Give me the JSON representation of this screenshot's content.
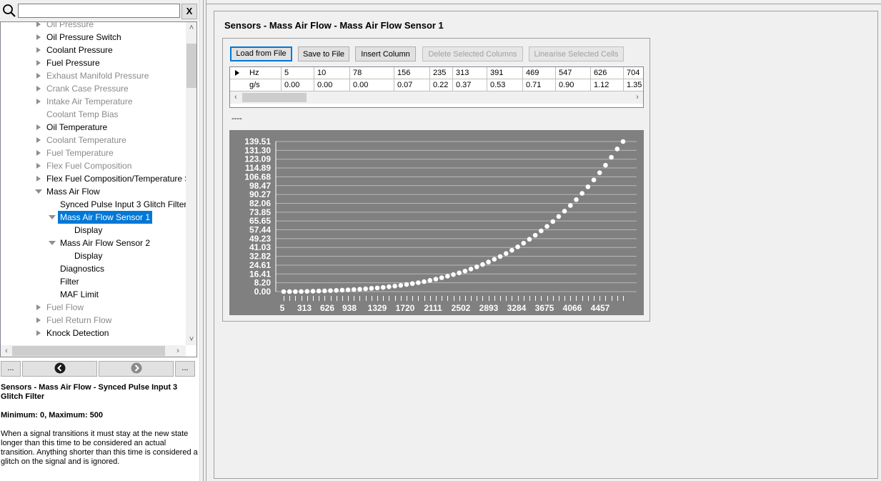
{
  "search": {
    "value": "",
    "clear_label": "X"
  },
  "tree": [
    {
      "label": "Oil Pressure",
      "level": 1,
      "arrow": "right",
      "disabled": true
    },
    {
      "label": "Oil Pressure Switch",
      "level": 1,
      "arrow": "right",
      "disabled": false
    },
    {
      "label": "Coolant Pressure",
      "level": 1,
      "arrow": "right",
      "disabled": false
    },
    {
      "label": "Fuel Pressure",
      "level": 1,
      "arrow": "right",
      "disabled": false
    },
    {
      "label": "Exhaust Manifold Pressure",
      "level": 1,
      "arrow": "right",
      "disabled": true
    },
    {
      "label": "Crank Case Pressure",
      "level": 1,
      "arrow": "right",
      "disabled": true
    },
    {
      "label": "Intake Air Temperature",
      "level": 1,
      "arrow": "right",
      "disabled": true
    },
    {
      "label": "Coolant Temp Bias",
      "level": 1,
      "arrow": "none",
      "disabled": true
    },
    {
      "label": "Oil Temperature",
      "level": 1,
      "arrow": "right",
      "disabled": false
    },
    {
      "label": "Coolant Temperature",
      "level": 1,
      "arrow": "right",
      "disabled": true
    },
    {
      "label": "Fuel Temperature",
      "level": 1,
      "arrow": "right",
      "disabled": true
    },
    {
      "label": "Flex Fuel Composition",
      "level": 1,
      "arrow": "right",
      "disabled": true
    },
    {
      "label": "Flex Fuel Composition/Temperature S",
      "level": 1,
      "arrow": "right",
      "disabled": false
    },
    {
      "label": "Mass Air Flow",
      "level": 1,
      "arrow": "down",
      "disabled": false
    },
    {
      "label": "Synced Pulse Input 3 Glitch Filter",
      "level": 2,
      "arrow": "none",
      "disabled": false
    },
    {
      "label": "Mass Air Flow Sensor 1",
      "level": 2,
      "arrow": "down",
      "disabled": false,
      "selected": true
    },
    {
      "label": "Display",
      "level": 3,
      "arrow": "none",
      "disabled": false
    },
    {
      "label": "Mass Air Flow Sensor 2",
      "level": 2,
      "arrow": "down",
      "disabled": false
    },
    {
      "label": "Display",
      "level": 3,
      "arrow": "none",
      "disabled": false
    },
    {
      "label": "Diagnostics",
      "level": 2,
      "arrow": "none",
      "disabled": false
    },
    {
      "label": "Filter",
      "level": 2,
      "arrow": "none",
      "disabled": false
    },
    {
      "label": "MAF Limit",
      "level": 2,
      "arrow": "none",
      "disabled": false
    },
    {
      "label": "Fuel Flow",
      "level": 1,
      "arrow": "right",
      "disabled": true
    },
    {
      "label": "Fuel Return Flow",
      "level": 1,
      "arrow": "right",
      "disabled": true
    },
    {
      "label": "Knock Detection",
      "level": 1,
      "arrow": "right",
      "disabled": false
    }
  ],
  "nav": {
    "more_left": "...",
    "more_right": "..."
  },
  "help": {
    "title": "Sensors - Mass Air Flow - Synced Pulse Input 3 Glitch Filter",
    "range": "Minimum: 0, Maximum: 500",
    "description": "When a signal transitions it must stay at the new state longer than this time to be considered an actual transition.  Anything shorter than this time is considered a glitch on the signal and is ignored."
  },
  "panel": {
    "title": "Sensors - Mass Air Flow - Mass Air Flow Sensor 1",
    "buttons": {
      "load": "Load from File",
      "save": "Save to File",
      "insert": "Insert Column",
      "delete": "Delete Selected Columns",
      "linearise": "Linearise Selected Cells"
    },
    "status": "----"
  },
  "table": {
    "row_headers": [
      "Hz",
      "g/s"
    ],
    "hz": [
      "5",
      "10",
      "78",
      "156",
      "235",
      "313",
      "391",
      "469",
      "547",
      "626",
      "704"
    ],
    "gs": [
      "0.00",
      "0.00",
      "0.00",
      "0.07",
      "0.22",
      "0.37",
      "0.53",
      "0.71",
      "0.90",
      "1.12",
      "1.35"
    ]
  },
  "chart_data": {
    "type": "scatter",
    "xlabel": "Hz",
    "ylabel": "g/s",
    "y_ticks": [
      "139.51",
      "131.30",
      "123.09",
      "114.89",
      "106.68",
      "98.47",
      "90.27",
      "82.06",
      "73.85",
      "65.65",
      "57.44",
      "49.23",
      "41.03",
      "32.82",
      "24.61",
      "16.41",
      "8.20",
      "0.00"
    ],
    "x_tick_labels": [
      "5",
      "313",
      "626",
      "938",
      "1329",
      "1720",
      "2111",
      "2502",
      "2893",
      "3284",
      "3675",
      "4066",
      "4457"
    ],
    "ylim": [
      0,
      139.51
    ],
    "y_values": [
      0.0,
      0.0,
      0.0,
      0.07,
      0.22,
      0.37,
      0.53,
      0.71,
      0.9,
      1.12,
      1.35,
      1.6,
      1.9,
      2.2,
      2.6,
      3.0,
      3.4,
      3.9,
      4.5,
      5.1,
      5.8,
      6.6,
      7.4,
      8.3,
      9.3,
      10.4,
      11.6,
      12.9,
      14.3,
      15.8,
      17.4,
      19.1,
      21.0,
      23.0,
      25.2,
      27.5,
      30.0,
      32.6,
      35.4,
      38.4,
      41.6,
      45.0,
      48.6,
      52.4,
      56.4,
      60.6,
      65.1,
      69.8,
      74.8,
      80.0,
      85.5,
      91.3,
      97.4,
      103.8,
      110.5,
      117.5,
      124.9,
      132.6,
      139.51
    ],
    "background": "#808080",
    "point_color": "#ffffff",
    "grid": true
  }
}
